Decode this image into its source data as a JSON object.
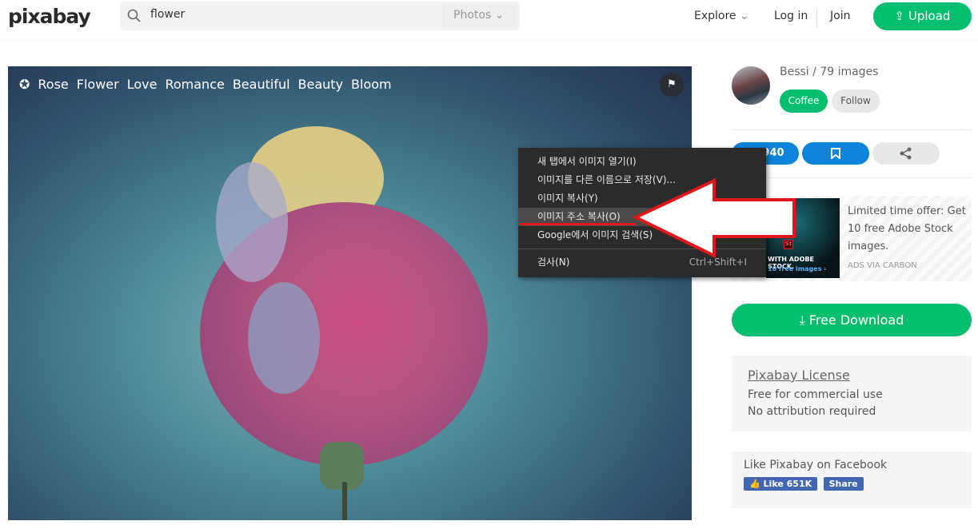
{
  "header": {
    "logo": "pixabay",
    "search_value": "flower",
    "search_type": "Photos",
    "nav": [
      "Explore",
      "Log in",
      "Join"
    ],
    "upload": "Upload"
  },
  "photo": {
    "tags": [
      "Rose",
      "Flower",
      "Love",
      "Romance",
      "Beautiful",
      "Beauty",
      "Bloom"
    ]
  },
  "context_menu": {
    "items": [
      {
        "label": "새 탭에서 이미지 열기(I)"
      },
      {
        "label": "이미지를 다른 이름으로 저장(V)..."
      },
      {
        "label": "이미지 복사(Y)"
      },
      {
        "label": "이미지 주소 복사(O)",
        "highlighted": true
      },
      {
        "label": "Google에서 이미지 검색(S)"
      },
      {
        "label": "검사(N)",
        "shortcut": "Ctrl+Shift+I"
      }
    ]
  },
  "sidebar": {
    "user": "Bessi / 79 images",
    "coffee": "Coffee",
    "follow": "Follow",
    "likes": "940",
    "ad": {
      "image_line1": "WITH ADOBE STOCK.",
      "image_line2": "10 free images ›",
      "badge": "St",
      "text": "Limited time offer: Get 10 free Adobe Stock images.",
      "via": "ADS VIA CARBON"
    },
    "download": "Free Download",
    "license": {
      "title": "Pixabay License",
      "lines": [
        "Free for commercial use",
        "No attribution required"
      ]
    },
    "facebook": {
      "title": "Like Pixabay on Facebook",
      "like": "Like 651K",
      "share": "Share"
    }
  },
  "colors": {
    "accent": "#02be6e",
    "blue": "#0d84d9",
    "arrow": "#e0161b"
  }
}
